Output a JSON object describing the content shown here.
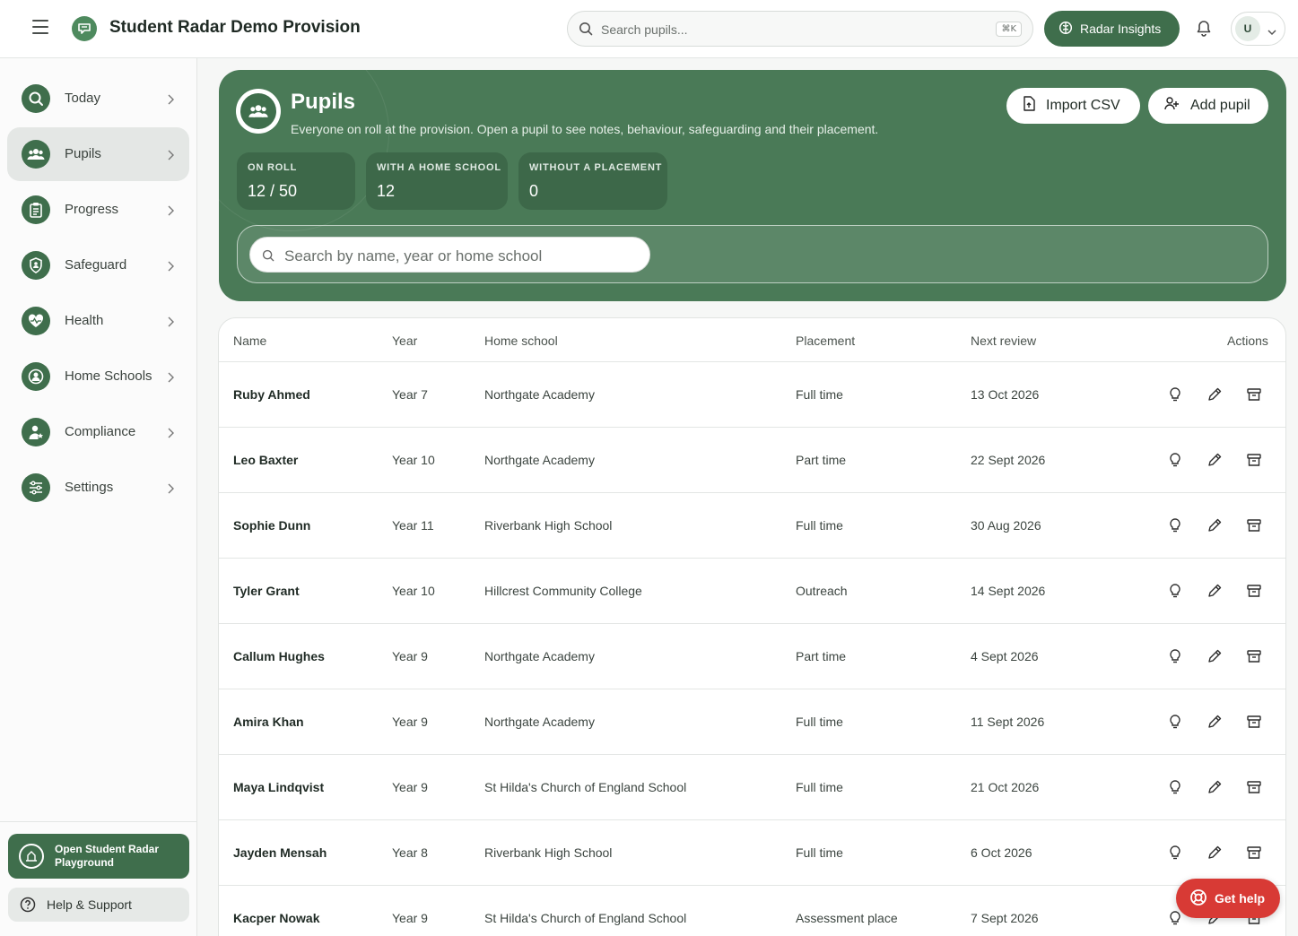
{
  "app": {
    "title": "Student Radar Demo Provision",
    "search_placeholder": "Search pupils...",
    "search_shortcut": "⌘K",
    "insights_label": "Radar Insights",
    "user_initial": "U"
  },
  "sidebar": {
    "items": [
      {
        "label": "Today",
        "icon": "search-icon"
      },
      {
        "label": "Pupils",
        "icon": "people-icon"
      },
      {
        "label": "Progress",
        "icon": "clipboard-icon"
      },
      {
        "label": "Safeguard",
        "icon": "shield-icon"
      },
      {
        "label": "Health",
        "icon": "heart-pulse-icon"
      },
      {
        "label": "Home Schools",
        "icon": "user-circle-icon"
      },
      {
        "label": "Compliance",
        "icon": "user-star-icon"
      },
      {
        "label": "Settings",
        "icon": "sliders-icon"
      }
    ],
    "active": "Pupils",
    "playground_label": "Open Student Radar Playground",
    "help_label": "Help & Support"
  },
  "hero": {
    "title": "Pupils",
    "subtitle": "Everyone on roll at the provision. Open a pupil to see notes, behaviour, safeguarding and their placement.",
    "import_label": "Import CSV",
    "add_label": "Add pupil",
    "stats": [
      {
        "label": "ON ROLL",
        "value": "12 / 50"
      },
      {
        "label": "WITH A HOME SCHOOL",
        "value": "12"
      },
      {
        "label": "WITHOUT A PLACEMENT",
        "value": "0"
      }
    ],
    "filter_placeholder": "Search by name, year or home school"
  },
  "table": {
    "headers": [
      "Name",
      "Year",
      "Home school",
      "Placement",
      "Next review",
      "Actions"
    ],
    "rows": [
      {
        "name": "Ruby Ahmed",
        "year": "Year 7",
        "school": "Northgate Academy",
        "placement": "Full time",
        "review": "13 Oct 2026"
      },
      {
        "name": "Leo Baxter",
        "year": "Year 10",
        "school": "Northgate Academy",
        "placement": "Part time",
        "review": "22 Sept 2026"
      },
      {
        "name": "Sophie Dunn",
        "year": "Year 11",
        "school": "Riverbank High School",
        "placement": "Full time",
        "review": "30 Aug 2026"
      },
      {
        "name": "Tyler Grant",
        "year": "Year 10",
        "school": "Hillcrest Community College",
        "placement": "Outreach",
        "review": "14 Sept 2026"
      },
      {
        "name": "Callum Hughes",
        "year": "Year 9",
        "school": "Northgate Academy",
        "placement": "Part time",
        "review": "4 Sept 2026"
      },
      {
        "name": "Amira Khan",
        "year": "Year 9",
        "school": "Northgate Academy",
        "placement": "Full time",
        "review": "11 Sept 2026"
      },
      {
        "name": "Maya Lindqvist",
        "year": "Year 9",
        "school": "St Hilda's Church of England School",
        "placement": "Full time",
        "review": "21 Oct 2026"
      },
      {
        "name": "Jayden Mensah",
        "year": "Year 8",
        "school": "Riverbank High School",
        "placement": "Full time",
        "review": "6 Oct 2026"
      },
      {
        "name": "Kacper Nowak",
        "year": "Year 9",
        "school": "St Hilda's Church of England School",
        "placement": "Assessment place",
        "review": "7 Sept 2026"
      }
    ]
  },
  "get_help_label": "Get help",
  "colors": {
    "primary": "#3f6e4c",
    "hero": "#4a7a57",
    "danger": "#d83a35"
  }
}
